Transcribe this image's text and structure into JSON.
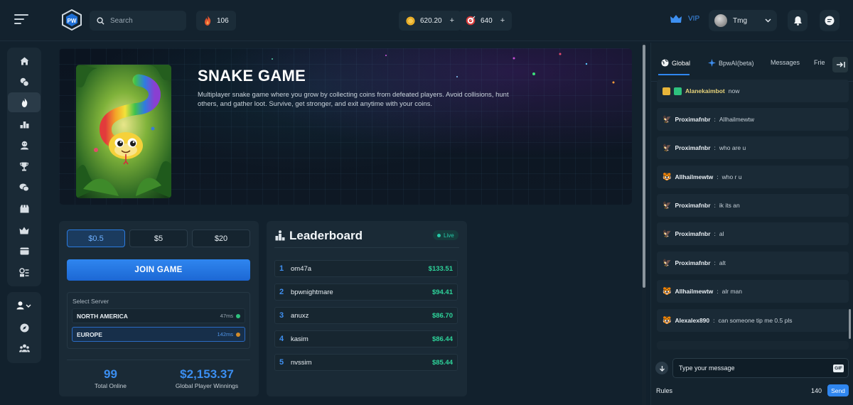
{
  "header": {
    "search_placeholder": "Search",
    "flame_count": "106",
    "coins": "620.20",
    "tokens": "640",
    "plus": "+",
    "vip_label": "VIP",
    "username": "Tmg",
    "logo_text": "PW"
  },
  "game": {
    "title": "SNAKE GAME",
    "description": "Multiplayer snake game where you grow by collecting coins from defeated players. Avoid collisions, hunt others, and gather loot. Survive, get stronger, and exit anytime with your coins."
  },
  "join": {
    "stakes": [
      "$0.5",
      "$5",
      "$20"
    ],
    "selected_stake": "$0.5",
    "join_label": "JOIN GAME",
    "server_label": "Select Server",
    "servers": [
      {
        "name": "NORTH AMERICA",
        "ping": "47ms",
        "color": "#2ec27e"
      },
      {
        "name": "EUROPE",
        "ping": "142ms",
        "color": "#d18b2a"
      }
    ],
    "selected_server": "EUROPE",
    "total_online": "99",
    "total_online_label": "Total Online",
    "winnings": "$2,153.37",
    "winnings_label": "Global Player Winnings"
  },
  "leaderboard": {
    "title": "Leaderboard",
    "live_label": "Live",
    "rows": [
      {
        "rank": "1",
        "name": "om47a",
        "amount": "$133.51"
      },
      {
        "rank": "2",
        "name": "bpwnightmare",
        "amount": "$94.41"
      },
      {
        "rank": "3",
        "name": "anuxz",
        "amount": "$86.70"
      },
      {
        "rank": "4",
        "name": "kasim",
        "amount": "$86.44"
      },
      {
        "rank": "5",
        "name": "nvssim",
        "amount": "$85.44"
      }
    ]
  },
  "chat": {
    "tabs": [
      "Global",
      "BpwAI(beta)",
      "Messages",
      "Frie"
    ],
    "active_tab": "Global",
    "messages": [
      {
        "user": "Alanekaimbot",
        "text": "now"
      },
      {
        "user": "Proximafnbr",
        "text": "Allhailmewtw"
      },
      {
        "user": "Proximafnbr",
        "text": "who are u"
      },
      {
        "user": "Allhailmewtw",
        "text": "who r u"
      },
      {
        "user": "Proximafnbr",
        "text": "ik its an"
      },
      {
        "user": "Proximafnbr",
        "text": "al"
      },
      {
        "user": "Proximafnbr",
        "text": "alt"
      },
      {
        "user": "Allhailmewtw",
        "text": "alr man"
      },
      {
        "user": "Alexalex890",
        "text": "can someone tip me 0.5 pls"
      }
    ],
    "separator": ":",
    "input_placeholder": "Type your message",
    "gif_label": "GIF",
    "rules_label": "Rules",
    "char_count": "140",
    "send_label": "Send"
  },
  "colors": {
    "accent": "#2f86ef",
    "money_green": "#2ed39a",
    "background": "#12212d",
    "panel": "#1a2a36"
  },
  "icons": {
    "sidebar": [
      "home-icon",
      "casino-chips-icon",
      "flame-icon",
      "leaderboard-icon",
      "character-icon",
      "trophy-icon",
      "chat-bubbles-icon",
      "store-icon",
      "crown-icon",
      "wallet-icon",
      "settings-list-icon"
    ],
    "sidebar_bottom": [
      "user-menu-icon",
      "compass-icon",
      "community-icon"
    ]
  }
}
